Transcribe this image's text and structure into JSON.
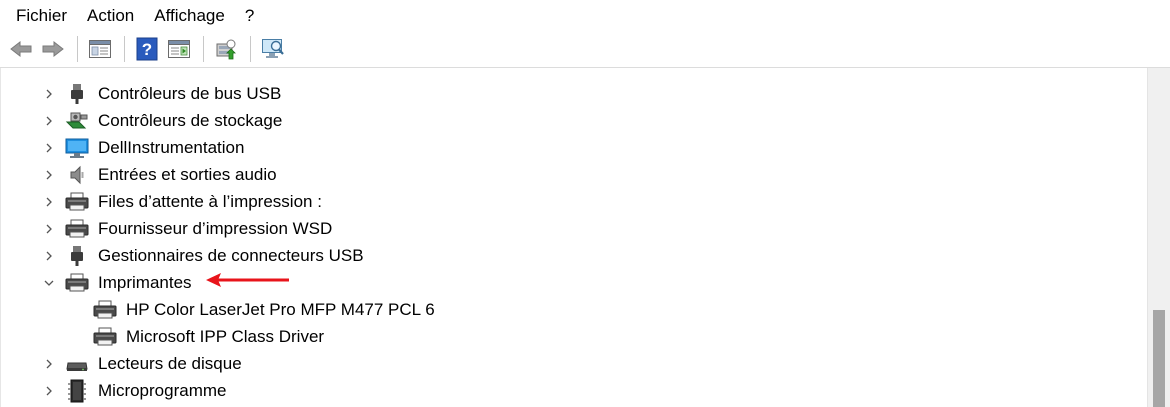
{
  "menu": {
    "items": [
      "Fichier",
      "Action",
      "Affichage",
      "?"
    ]
  },
  "toolbar": {
    "buttons": [
      "back-arrow-icon",
      "forward-arrow-icon",
      "show-hide-console-tree-icon",
      "help-icon",
      "properties-pane-icon",
      "update-driver-icon",
      "scan-hardware-icon"
    ]
  },
  "tree": {
    "items": [
      {
        "label": "Contrôleurs de bus USB",
        "expanded": false,
        "level": 0,
        "icon": "usb-plug-icon"
      },
      {
        "label": "Contrôleurs de stockage",
        "expanded": false,
        "level": 0,
        "icon": "storage-controller-icon"
      },
      {
        "label": "DellInstrumentation",
        "expanded": false,
        "level": 0,
        "icon": "monitor-icon"
      },
      {
        "label": "Entrées et sorties audio",
        "expanded": false,
        "level": 0,
        "icon": "speaker-icon"
      },
      {
        "label": "Files d’attente à l’impression :",
        "expanded": false,
        "level": 0,
        "icon": "printer-icon"
      },
      {
        "label": "Fournisseur d’impression WSD",
        "expanded": false,
        "level": 0,
        "icon": "printer-icon"
      },
      {
        "label": "Gestionnaires de connecteurs USB",
        "expanded": false,
        "level": 0,
        "icon": "usb-plug-icon"
      },
      {
        "label": "Imprimantes",
        "expanded": true,
        "level": 0,
        "icon": "printer-icon"
      },
      {
        "label": "HP Color LaserJet Pro MFP M477 PCL 6",
        "level": 1,
        "icon": "printer-icon"
      },
      {
        "label": "Microsoft IPP Class Driver",
        "level": 1,
        "icon": "printer-icon"
      },
      {
        "label": "Lecteurs de disque",
        "expanded": false,
        "level": 0,
        "icon": "disk-drive-icon"
      },
      {
        "label": "Microprogramme",
        "expanded": false,
        "level": 0,
        "icon": "firmware-chip-icon"
      }
    ]
  },
  "colors": {
    "annotation_arrow": "#e8141b"
  }
}
